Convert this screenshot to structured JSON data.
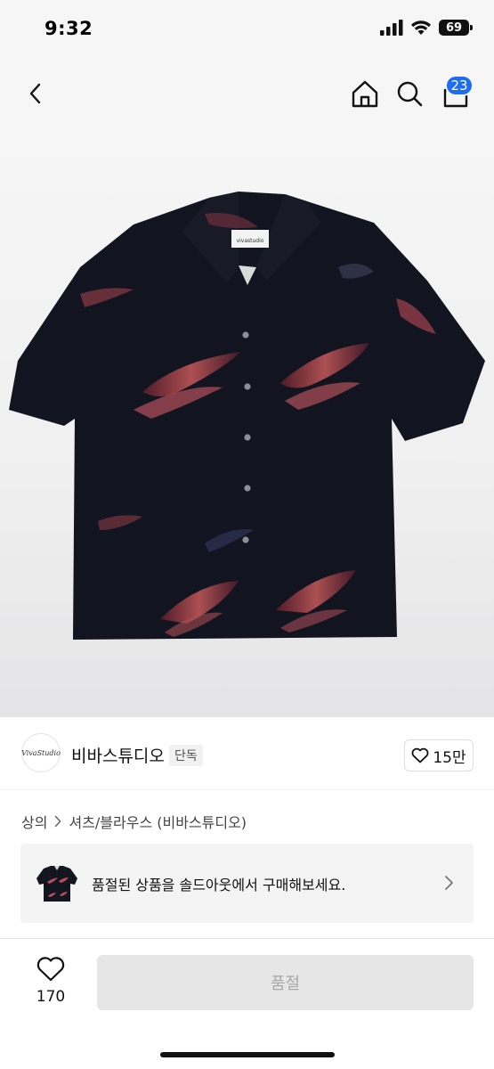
{
  "status_bar": {
    "time": "9:32",
    "battery": "69"
  },
  "header": {
    "back_icon": "chevron-left-icon",
    "home_icon": "home-icon",
    "search_icon": "search-icon",
    "cart_icon": "shopping-bag-icon",
    "cart_count": "23",
    "badge_color": "#1f6cf0"
  },
  "product": {
    "image": "black short-sleeve shirt with red/purple brushstroke print",
    "label": "vivastudio"
  },
  "brand": {
    "logo_text": "VivaStudio",
    "name": "비바스튜디오",
    "tag": "단독",
    "likes": "15만"
  },
  "breadcrumb": {
    "category": "상의",
    "subcategory": "셔츠/블라우스 (비바스튜디오)"
  },
  "soldout_banner": {
    "text": "품절된 상품을 솔드아웃에서 구매해보세요."
  },
  "bottom_bar": {
    "like_count": "170",
    "button_label": "품절"
  }
}
